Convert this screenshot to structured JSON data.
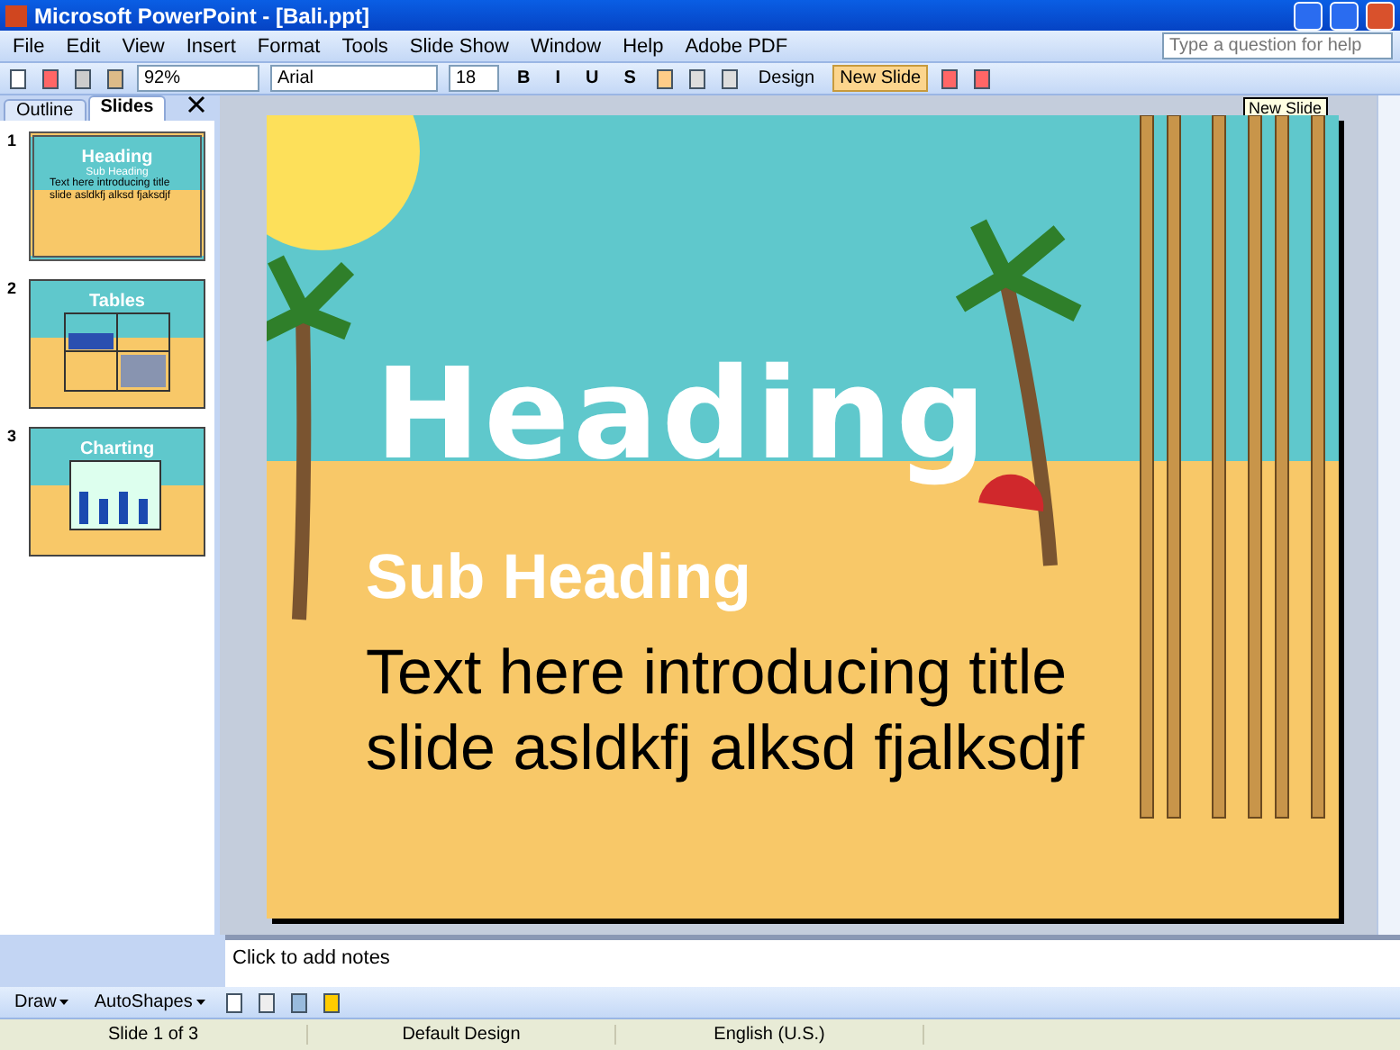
{
  "window": {
    "title": "Microsoft PowerPoint - [Bali.ppt]"
  },
  "menu": [
    "File",
    "Edit",
    "View",
    "Insert",
    "Format",
    "Tools",
    "Slide Show",
    "Window",
    "Help",
    "Adobe PDF"
  ],
  "help_box": {
    "placeholder": "Type a question for help"
  },
  "toolbar": {
    "zoom": "92%",
    "font": "Arial",
    "font_size": "18",
    "style_buttons": [
      "B",
      "I",
      "U",
      "S"
    ],
    "design_button": "Design",
    "new_slide_button": "New Slide",
    "tooltip": "New Slide"
  },
  "pane_tabs": [
    {
      "label": "Outline",
      "selected": false
    },
    {
      "label": "Slides",
      "selected": true
    }
  ],
  "thumbnails": [
    {
      "number": "1",
      "selected": true,
      "kind": "title",
      "title": "Heading",
      "subtitle": "Sub Heading",
      "body": "Text here introducing title slide asldkfj alksd fjaksdjf"
    },
    {
      "number": "2",
      "selected": false,
      "kind": "table",
      "title": "Tables"
    },
    {
      "number": "3",
      "selected": false,
      "kind": "chart",
      "title": "Charting"
    }
  ],
  "slide": {
    "heading": "Heading",
    "subheading": "Sub Heading",
    "body": "Text here introducing title slide asldkfj alksd fjalksdjf"
  },
  "notes": {
    "placeholder": "Click to add notes"
  },
  "draw_toolbar": {
    "draw": "Draw",
    "autoshapes": "AutoShapes"
  },
  "status_bar": [
    "Slide 1 of 3",
    "Default Design",
    "English (U.S.)"
  ]
}
